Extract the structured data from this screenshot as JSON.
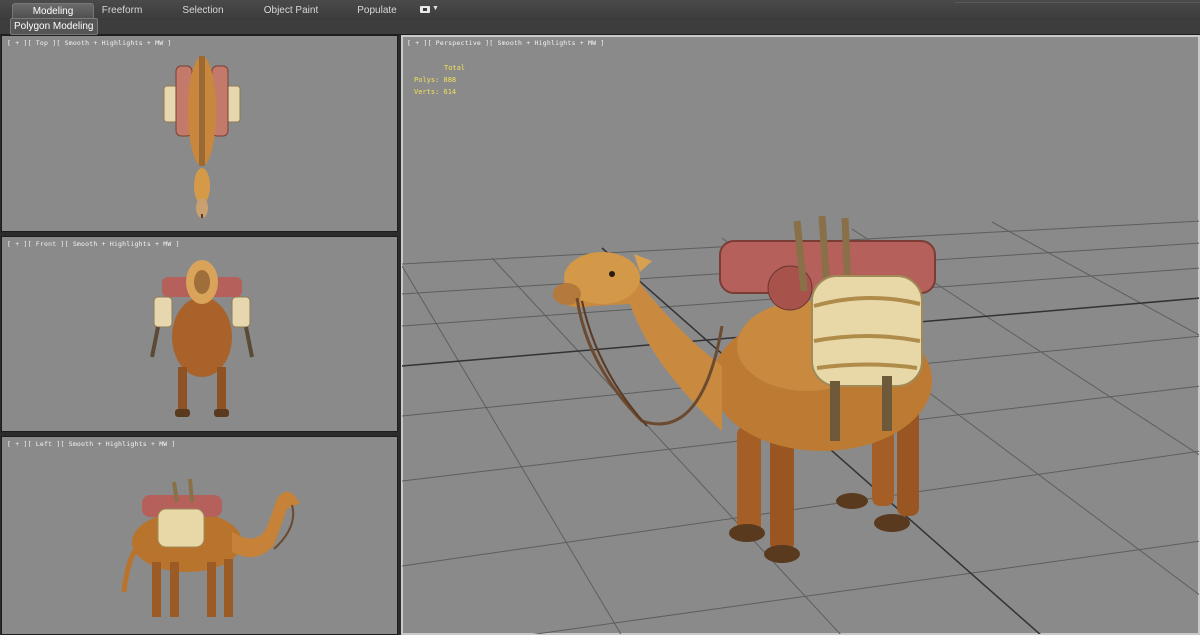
{
  "ribbon": {
    "tabs": [
      {
        "label": "Modeling",
        "active": true
      },
      {
        "label": "Freeform",
        "active": false
      },
      {
        "label": "Selection",
        "active": false
      },
      {
        "label": "Object Paint",
        "active": false
      },
      {
        "label": "Populate",
        "active": false
      }
    ],
    "dropdown_icon": "display-options-icon",
    "panel_label": "Polygon Modeling"
  },
  "viewports": {
    "top": {
      "label": "[ + ][ Top ][ Smooth + Highlights + MW ]"
    },
    "front": {
      "label": "[ + ][ Front ][ Smooth + Highlights + MW ]"
    },
    "left": {
      "label": "[ + ][ Left ][ Smooth + Highlights + MW ]"
    },
    "perspective": {
      "label": "[ + ][ Perspective ][ Smooth + Highlights + MW ]"
    }
  },
  "stats": {
    "header": "Total",
    "polys": "Polys: 888",
    "verts": "Verts: 614"
  },
  "colors": {
    "viewport_bg": "#8a8a8a",
    "grid": "#5e5e5e",
    "stats_text": "#f0e05a",
    "camel_fur": "#b8742c",
    "saddle_red": "#b5605a",
    "sack_cream": "#e8d8a8"
  }
}
